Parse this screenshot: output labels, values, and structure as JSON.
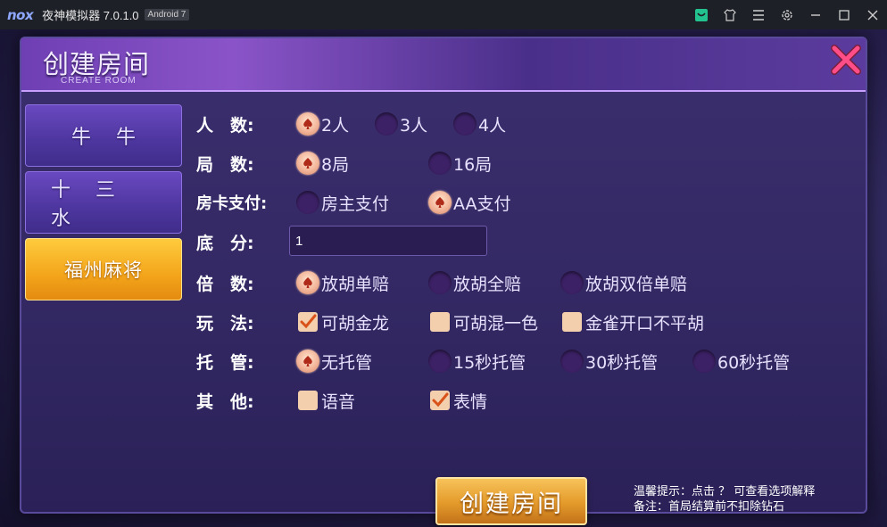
{
  "emulator": {
    "logo": "nox",
    "title": "夜神模拟器 7.0.1.0",
    "android_badge": "Android 7",
    "icons": [
      "shop-icon",
      "shirt-icon",
      "menu-icon",
      "settings-icon",
      "minimize-icon",
      "maximize-icon",
      "close-icon"
    ]
  },
  "dialog": {
    "title": "创建房间",
    "subtitle": "CREATE ROOM"
  },
  "tabs": [
    {
      "label": "牛牛",
      "active": false
    },
    {
      "label": "十三水",
      "active": false
    },
    {
      "label": "福州麻将",
      "active": true
    }
  ],
  "form": {
    "players": {
      "label": "人　数:",
      "options": [
        "2人",
        "3人",
        "4人"
      ],
      "selected": "2人"
    },
    "rounds": {
      "label": "局　数:",
      "options": [
        "8局",
        "16局"
      ],
      "selected": "8局"
    },
    "card_pay": {
      "label": "房卡支付:",
      "options": [
        "房主支付",
        "AA支付"
      ],
      "selected": "AA支付"
    },
    "base_score": {
      "label": "底　分:",
      "value": "1"
    },
    "multiplier": {
      "label": "倍　数:",
      "options": [
        "放胡单赔",
        "放胡全赔",
        "放胡双倍单赔"
      ],
      "selected": "放胡单赔"
    },
    "rules": {
      "label": "玩　法:",
      "options": [
        {
          "label": "可胡金龙",
          "checked": true
        },
        {
          "label": "可胡混一色",
          "checked": false
        },
        {
          "label": "金雀开口不平胡",
          "checked": false
        }
      ]
    },
    "auto_play": {
      "label": "托　管:",
      "options": [
        "无托管",
        "15秒托管",
        "30秒托管",
        "60秒托管"
      ],
      "selected": "无托管"
    },
    "other": {
      "label": "其　他:",
      "options": [
        {
          "label": "语音",
          "checked": false
        },
        {
          "label": "表情",
          "checked": true
        }
      ]
    }
  },
  "create_button": "创建房间",
  "hint_line1": "温馨提示：点击 ？ 可查看选项解释",
  "hint_line2": "备注：首局结算前不扣除钻石",
  "colors": {
    "accent_gold": "#f3a51b",
    "dialog_purple": "#342964",
    "close_pink": "#e8417a"
  }
}
